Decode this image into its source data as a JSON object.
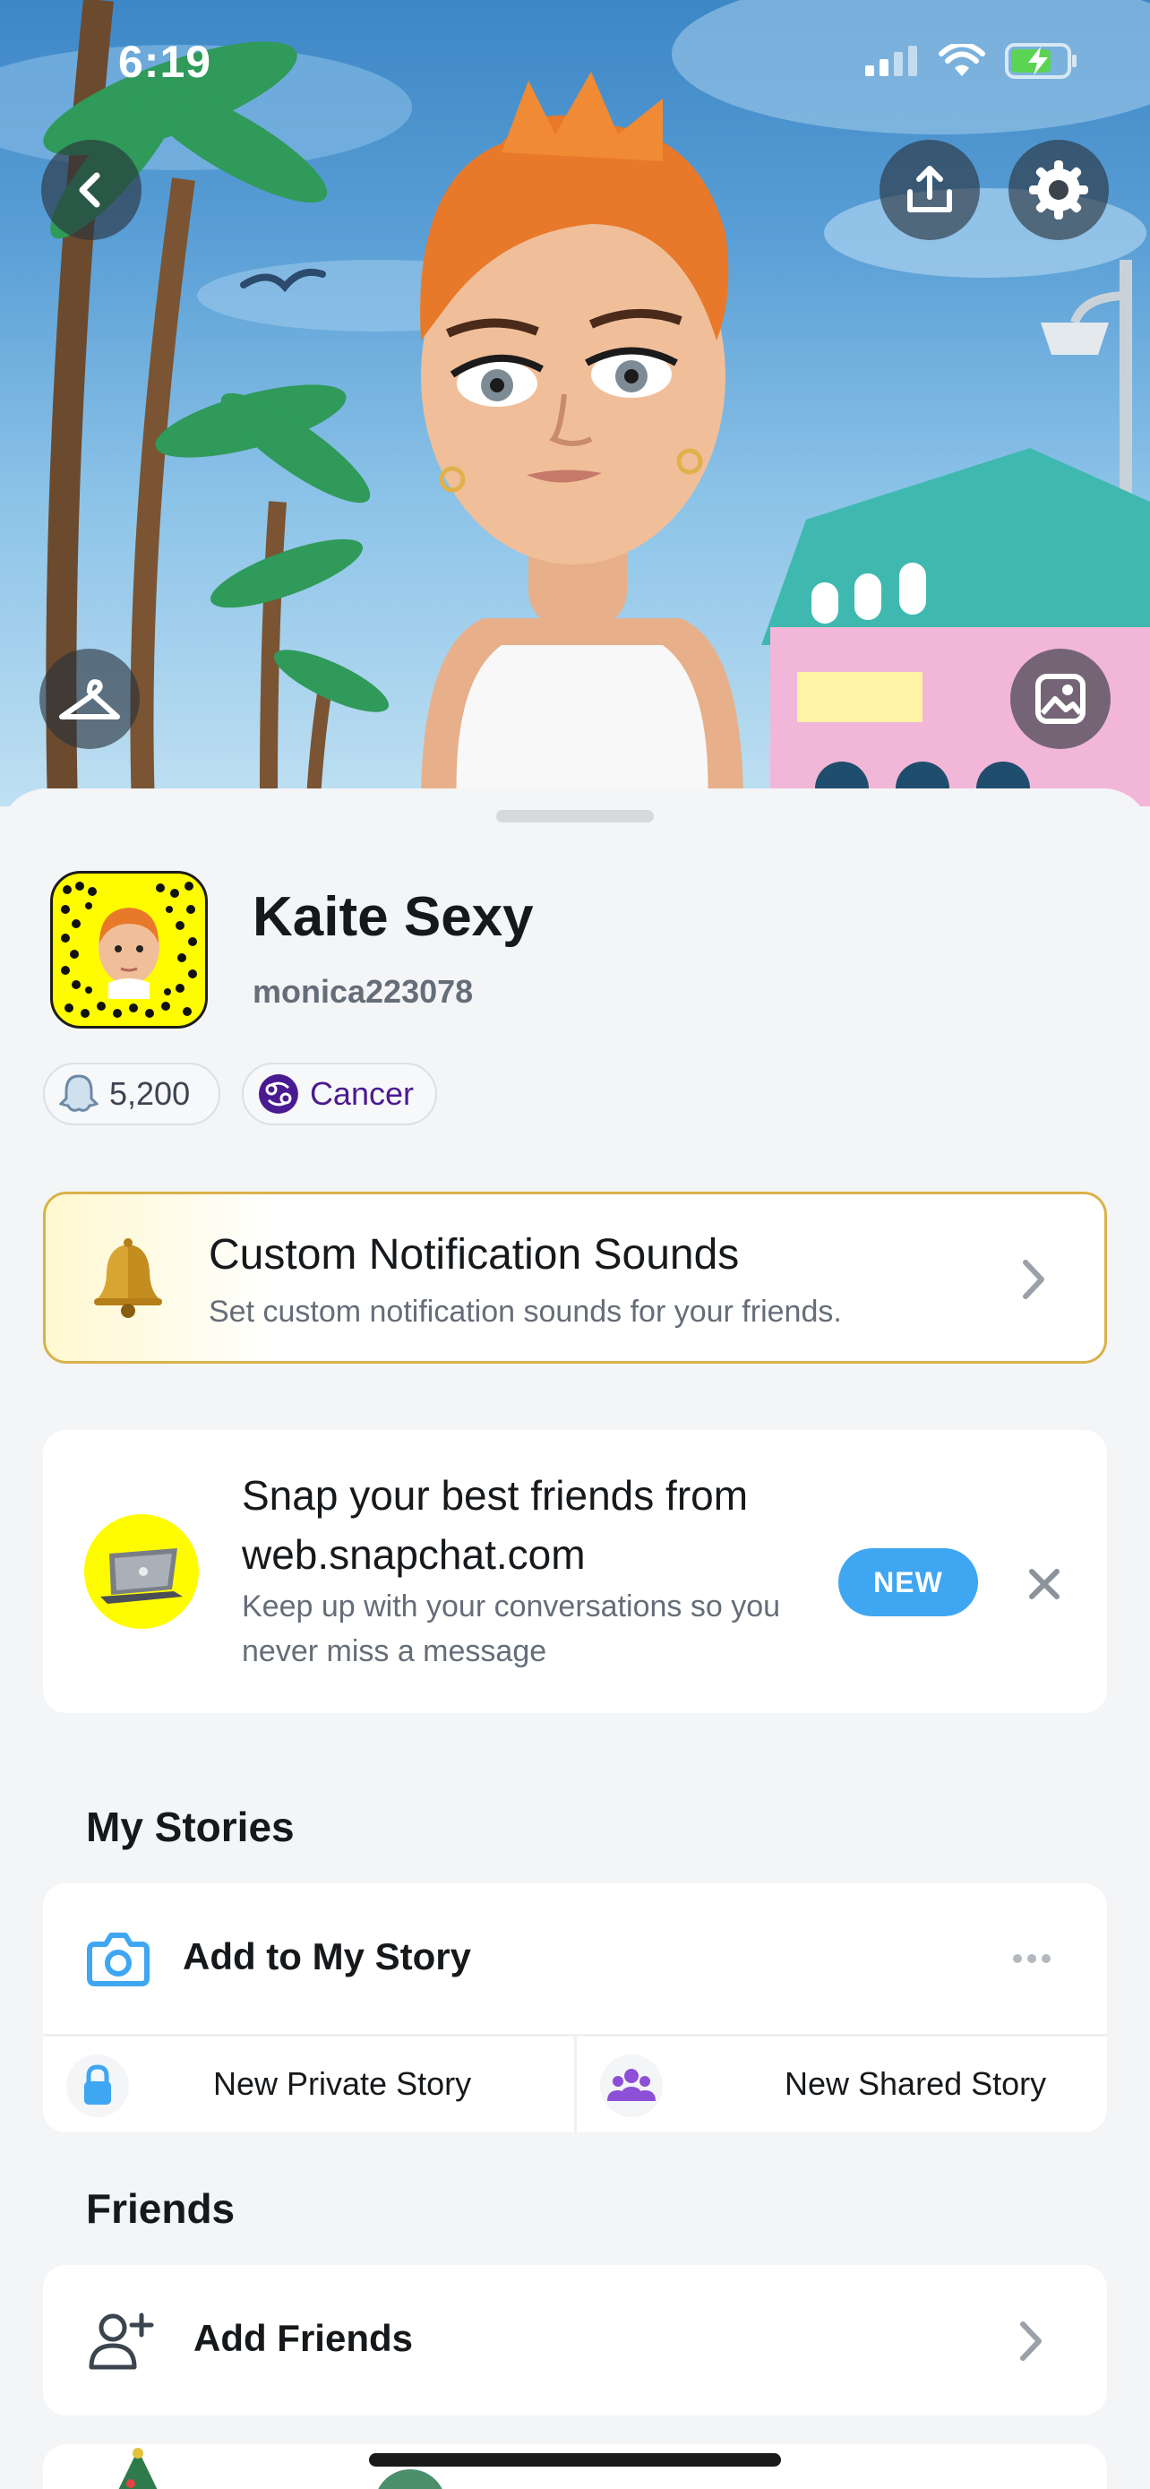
{
  "status_bar": {
    "time": "6:19"
  },
  "profile": {
    "display_name": "Kaite Sexy",
    "username": "monica223078",
    "snap_score": "5,200",
    "zodiac": "Cancer"
  },
  "notification_card": {
    "title": "Custom Notification Sounds",
    "subtitle": "Set custom notification sounds for your friends.",
    "icon": "bell-icon"
  },
  "promo_card": {
    "title": "Snap your best friends from web.snapchat.com",
    "subtitle": "Keep up with your conversations so you never miss a message",
    "badge": "NEW",
    "icon": "laptop-icon"
  },
  "my_stories": {
    "heading": "My Stories",
    "add_story": "Add to My Story",
    "private_story": "New Private Story",
    "shared_story": "New Shared Story"
  },
  "friends": {
    "heading": "Friends",
    "add_friends": "Add Friends"
  },
  "colors": {
    "snap_yellow": "#fffc00",
    "new_badge_blue": "#3fa6f2",
    "zodiac_purple": "#4a1a91",
    "story_blue": "#3fa6f2",
    "shared_purple": "#8d4fd6"
  }
}
